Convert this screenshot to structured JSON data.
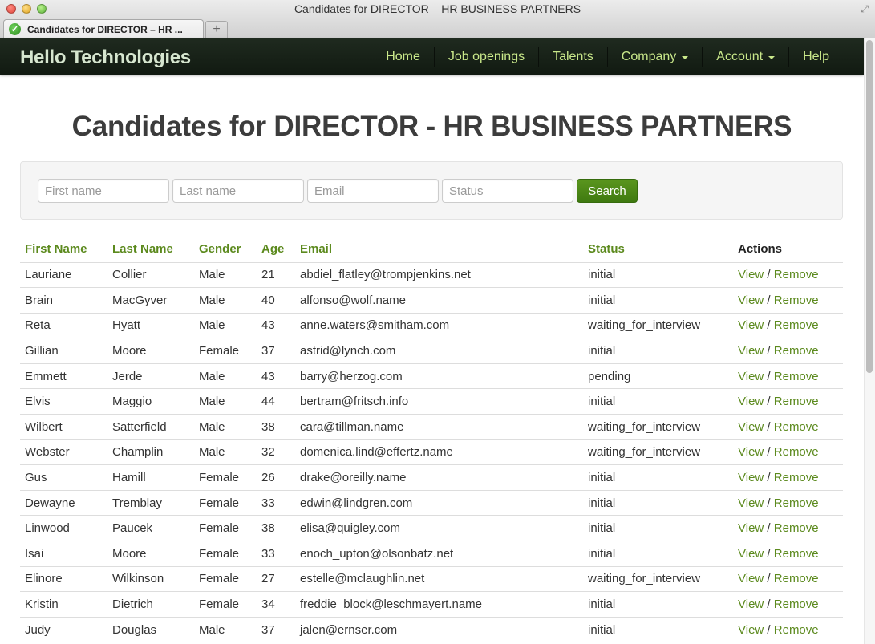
{
  "window": {
    "title": "Candidates for DIRECTOR – HR BUSINESS PARTNERS",
    "tab_label": "Candidates for DIRECTOR – HR ...",
    "new_tab_symbol": "+"
  },
  "navbar": {
    "brand": "Hello Technologies",
    "items": [
      {
        "label": "Home",
        "has_caret": false
      },
      {
        "label": "Job openings",
        "has_caret": false
      },
      {
        "label": "Talents",
        "has_caret": false
      },
      {
        "label": "Company",
        "has_caret": true
      },
      {
        "label": "Account",
        "has_caret": true
      },
      {
        "label": "Help",
        "has_caret": false
      }
    ]
  },
  "page": {
    "title": "Candidates for DIRECTOR - HR BUSINESS PARTNERS"
  },
  "search": {
    "first_name": {
      "placeholder": "First name",
      "value": ""
    },
    "last_name": {
      "placeholder": "Last name",
      "value": ""
    },
    "email": {
      "placeholder": "Email",
      "value": ""
    },
    "status": {
      "placeholder": "Status",
      "value": ""
    },
    "button_label": "Search"
  },
  "table": {
    "headers": [
      "First Name",
      "Last Name",
      "Gender",
      "Age",
      "Email",
      "Status",
      "Actions"
    ],
    "action_view": "View",
    "action_separator": "/",
    "action_remove": "Remove",
    "rows": [
      {
        "first": "Lauriane",
        "last": "Collier",
        "gender": "Male",
        "age": "21",
        "email": "abdiel_flatley@trompjenkins.net",
        "status": "initial"
      },
      {
        "first": "Brain",
        "last": "MacGyver",
        "gender": "Male",
        "age": "40",
        "email": "alfonso@wolf.name",
        "status": "initial"
      },
      {
        "first": "Reta",
        "last": "Hyatt",
        "gender": "Male",
        "age": "43",
        "email": "anne.waters@smitham.com",
        "status": "waiting_for_interview"
      },
      {
        "first": "Gillian",
        "last": "Moore",
        "gender": "Female",
        "age": "37",
        "email": "astrid@lynch.com",
        "status": "initial"
      },
      {
        "first": "Emmett",
        "last": "Jerde",
        "gender": "Male",
        "age": "43",
        "email": "barry@herzog.com",
        "status": "pending"
      },
      {
        "first": "Elvis",
        "last": "Maggio",
        "gender": "Male",
        "age": "44",
        "email": "bertram@fritsch.info",
        "status": "initial"
      },
      {
        "first": "Wilbert",
        "last": "Satterfield",
        "gender": "Male",
        "age": "38",
        "email": "cara@tillman.name",
        "status": "waiting_for_interview"
      },
      {
        "first": "Webster",
        "last": "Champlin",
        "gender": "Male",
        "age": "32",
        "email": "domenica.lind@effertz.name",
        "status": "waiting_for_interview"
      },
      {
        "first": "Gus",
        "last": "Hamill",
        "gender": "Female",
        "age": "26",
        "email": "drake@oreilly.name",
        "status": "initial"
      },
      {
        "first": "Dewayne",
        "last": "Tremblay",
        "gender": "Female",
        "age": "33",
        "email": "edwin@lindgren.com",
        "status": "initial"
      },
      {
        "first": "Linwood",
        "last": "Paucek",
        "gender": "Female",
        "age": "38",
        "email": "elisa@quigley.com",
        "status": "initial"
      },
      {
        "first": "Isai",
        "last": "Moore",
        "gender": "Female",
        "age": "33",
        "email": "enoch_upton@olsonbatz.net",
        "status": "initial"
      },
      {
        "first": "Elinore",
        "last": "Wilkinson",
        "gender": "Female",
        "age": "27",
        "email": "estelle@mclaughlin.net",
        "status": "waiting_for_interview"
      },
      {
        "first": "Kristin",
        "last": "Dietrich",
        "gender": "Female",
        "age": "34",
        "email": "freddie_block@leschmayert.name",
        "status": "initial"
      },
      {
        "first": "Judy",
        "last": "Douglas",
        "gender": "Male",
        "age": "37",
        "email": "jalen@ernser.com",
        "status": "initial"
      }
    ]
  },
  "colors": {
    "accent": "#5c8a1e",
    "nav_text": "#c9e88a",
    "navbar_bg": "#161f16",
    "button_bg": "#4a8817"
  }
}
